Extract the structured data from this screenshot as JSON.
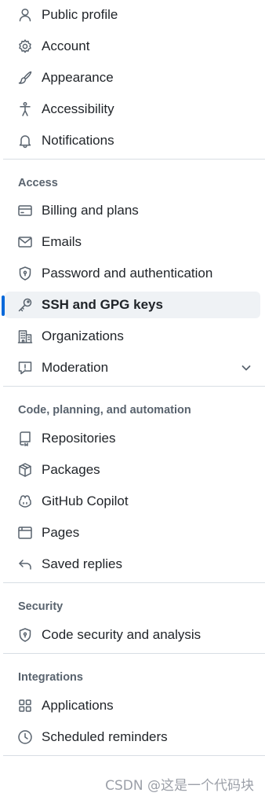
{
  "nav": {
    "group1": [
      {
        "label": "Public profile",
        "icon": "person-icon"
      },
      {
        "label": "Account",
        "icon": "gear-icon"
      },
      {
        "label": "Appearance",
        "icon": "paintbrush-icon"
      },
      {
        "label": "Accessibility",
        "icon": "accessibility-icon"
      },
      {
        "label": "Notifications",
        "icon": "bell-icon"
      }
    ],
    "access": {
      "heading": "Access",
      "items": [
        {
          "label": "Billing and plans",
          "icon": "credit-card-icon"
        },
        {
          "label": "Emails",
          "icon": "mail-icon"
        },
        {
          "label": "Password and authentication",
          "icon": "shield-lock-icon"
        },
        {
          "label": "SSH and GPG keys",
          "icon": "key-icon",
          "active": true
        },
        {
          "label": "Organizations",
          "icon": "organization-icon"
        },
        {
          "label": "Moderation",
          "icon": "report-icon",
          "expandable": true
        }
      ]
    },
    "code": {
      "heading": "Code, planning, and automation",
      "items": [
        {
          "label": "Repositories",
          "icon": "repo-icon"
        },
        {
          "label": "Packages",
          "icon": "package-icon"
        },
        {
          "label": "GitHub Copilot",
          "icon": "copilot-icon"
        },
        {
          "label": "Pages",
          "icon": "browser-icon"
        },
        {
          "label": "Saved replies",
          "icon": "reply-icon"
        }
      ]
    },
    "security": {
      "heading": "Security",
      "items": [
        {
          "label": "Code security and analysis",
          "icon": "shield-lock-icon"
        }
      ]
    },
    "integrations": {
      "heading": "Integrations",
      "items": [
        {
          "label": "Applications",
          "icon": "apps-icon"
        },
        {
          "label": "Scheduled reminders",
          "icon": "clock-icon"
        }
      ]
    }
  },
  "watermark": "CSDN @这是一个代码块",
  "colors": {
    "accent": "#0969da",
    "active_bg": "#eff2f5",
    "text": "#1f2328",
    "muted": "#59636e",
    "divider": "#d8dee4"
  }
}
